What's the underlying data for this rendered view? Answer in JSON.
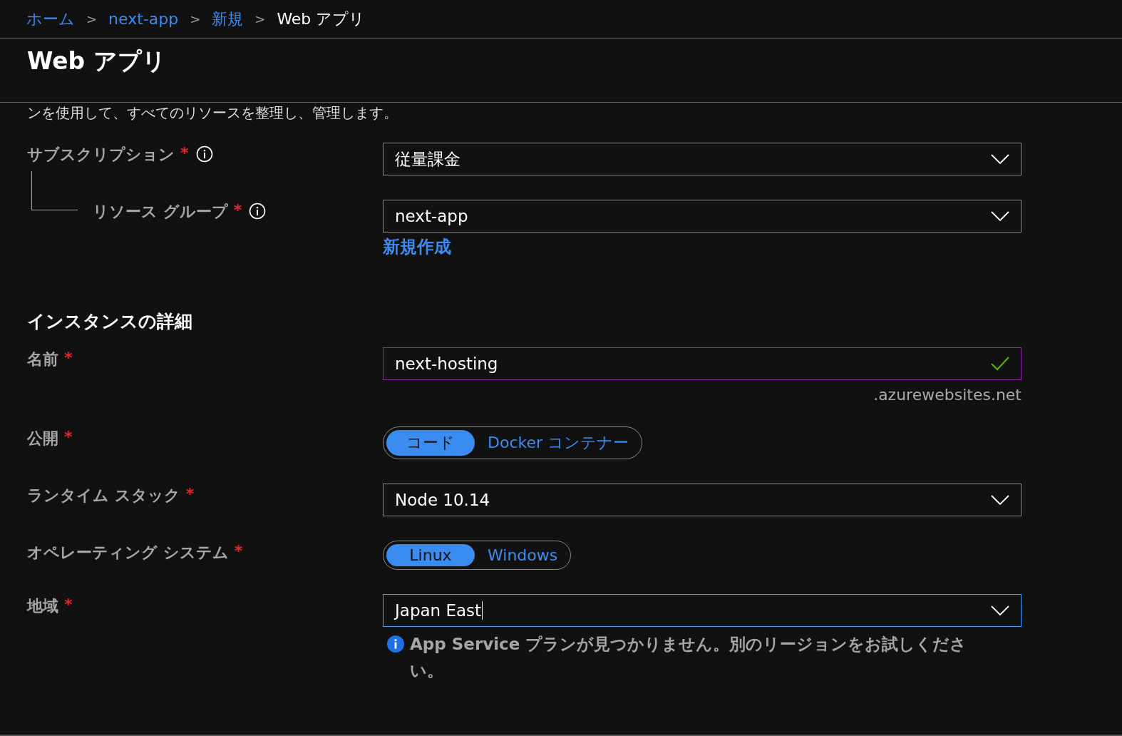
{
  "breadcrumb": [
    {
      "label": "ホーム",
      "link": true
    },
    {
      "label": "next-app",
      "link": true
    },
    {
      "label": "新規",
      "link": true
    },
    {
      "label": "Web アプリ",
      "link": false
    }
  ],
  "separator": ">",
  "title": "Web アプリ",
  "intro": "ンを使用して、すべてのリソースを整理し、管理します。",
  "project_rows": [
    {
      "label": "サブスクリプション",
      "required_mark": "*",
      "info": true,
      "indent": false,
      "kind": "dropdown",
      "value": "従量課金",
      "focused": false
    },
    {
      "label": "リソース グループ",
      "required_mark": "*",
      "info": true,
      "indent": true,
      "kind": "dropdown",
      "value": "next-app",
      "focused": false,
      "link": "新規作成"
    }
  ],
  "section_title": "インスタンスの詳細",
  "instance_rows": [
    {
      "label": "名前",
      "required_mark": "*",
      "info": false,
      "indent": false,
      "kind": "text",
      "value": "next-hosting",
      "valid": true,
      "focused": false,
      "suffix": ".azurewebsites.net"
    },
    {
      "label": "公開",
      "required_mark": "*",
      "info": false,
      "indent": false,
      "kind": "toggle",
      "options": [
        {
          "label": "コード",
          "selected": true
        },
        {
          "label": "Docker コンテナー",
          "selected": false
        }
      ]
    },
    {
      "label": "ランタイム スタック",
      "required_mark": "*",
      "info": false,
      "indent": false,
      "kind": "dropdown",
      "value": "Node 10.14",
      "focused": false
    },
    {
      "label": "オペレーティング システム",
      "required_mark": "*",
      "info": false,
      "indent": false,
      "kind": "toggle",
      "options": [
        {
          "label": "Linux",
          "selected": true
        },
        {
          "label": "Windows",
          "selected": false
        }
      ]
    },
    {
      "label": "地域",
      "required_mark": "*",
      "info": false,
      "indent": false,
      "kind": "dropdown",
      "value": "Japan East",
      "focused": true,
      "message": "App Service プランが見つかりません。別のリージョンをお試しください。"
    }
  ]
}
